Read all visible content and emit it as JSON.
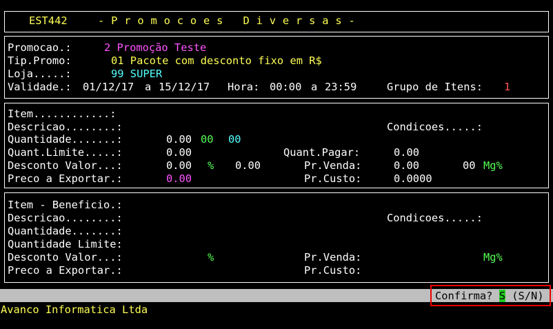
{
  "header": {
    "code": "EST442",
    "title": "- P r o m o c o e s   D i v e r s a s -"
  },
  "promo": {
    "promocao_label": "Promocao.:",
    "promocao_value": "2 Promoção Teste",
    "tip_label": "Tip.Promo:",
    "tip_value": "01 Pacote com desconto fixo em R$",
    "loja_label": "Loja.....:",
    "loja_value": "99 SUPER",
    "validade_label": "Validade.:",
    "validade_from": "01/12/17",
    "validade_sep": "a",
    "validade_to": "15/12/17",
    "hora_label": "Hora:",
    "hora_from": "00:00",
    "hora_sep": "a",
    "hora_to": "23:59",
    "grupo_label": "Grupo de Itens:",
    "grupo_value": "1"
  },
  "item": {
    "item_label": "Item............:",
    "descricao_label": "Descricao........:",
    "condicoes_label": "Condicoes.....:",
    "quantidade_label": "Quantidade.......:",
    "quantidade_value": "0.00",
    "quantidade_v2": "00",
    "quantidade_v3": "00",
    "quant_limite_label": "Quant.Limite.....:",
    "quant_limite_value": "0.00",
    "quant_pagar_label": "Quant.Pagar:",
    "quant_pagar_value": "0.00",
    "desconto_label": "Desconto Valor...:",
    "desconto_value": "0.00",
    "desconto_pct": "%",
    "desconto_value2": "0.00",
    "pr_venda_label": "Pr.Venda:",
    "pr_venda_value": "0.00",
    "mg_value": "00",
    "mg_label": "Mg%",
    "preco_exp_label": "Preco a Exportar.:",
    "preco_exp_value": "0.00",
    "pr_custo_label": "Pr.Custo:",
    "pr_custo_value": "0.0000"
  },
  "beneficio": {
    "item_label": "Item - Beneficio.:",
    "descricao_label": "Descricao........:",
    "condicoes_label": "Condicoes.....:",
    "quantidade_label": "Quantidade.......:",
    "quant_limite_label": "Quantidade Limite:",
    "desconto_label": "Desconto Valor...:",
    "desconto_pct": "%",
    "pr_venda_label": "Pr.Venda:",
    "mg_label": "Mg%",
    "preco_exp_label": "Preco a Exportar.:",
    "pr_custo_label": "Pr.Custo:"
  },
  "status": {
    "confirm_label": "Confirma?",
    "confirm_value": "S",
    "confirm_options": "(S/N)"
  },
  "footer": {
    "company": "Avanco Informatica Ltda"
  }
}
